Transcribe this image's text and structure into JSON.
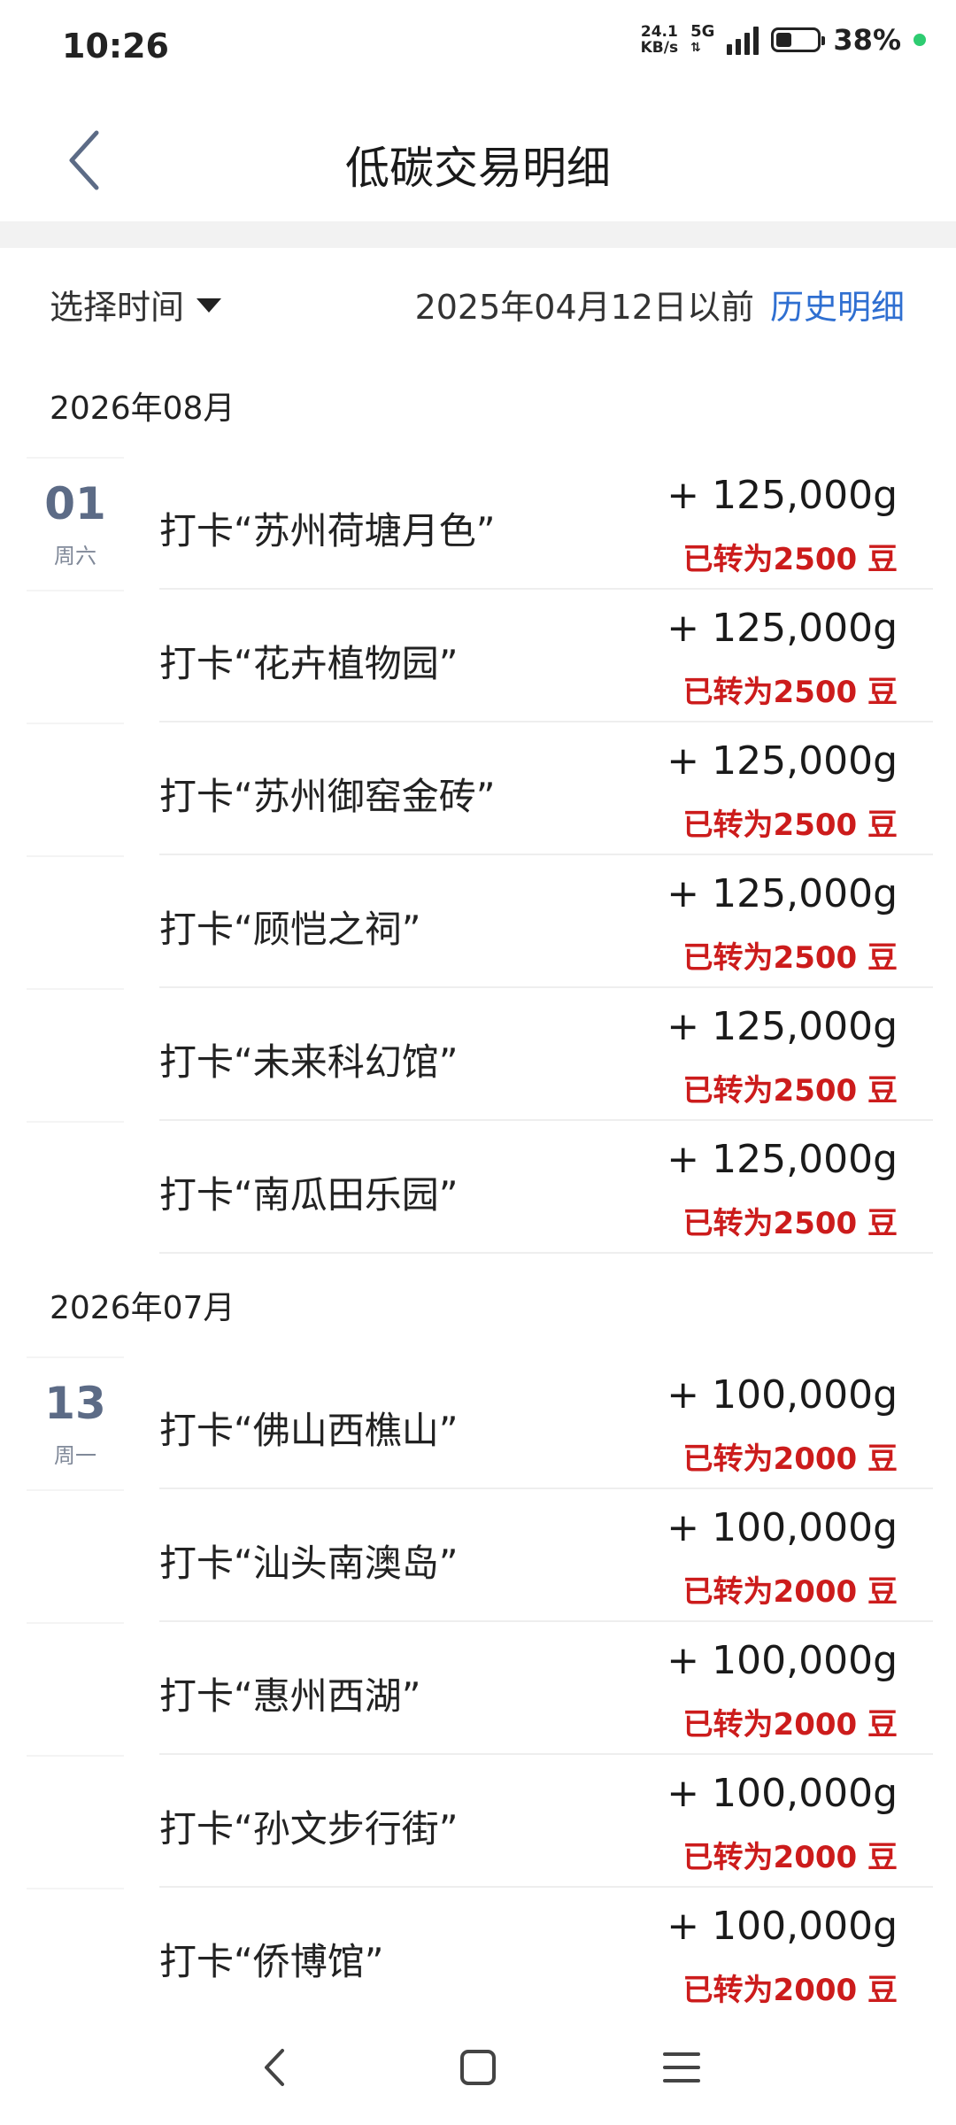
{
  "status_bar": {
    "time": "10:26",
    "speed_top": "24.1",
    "speed_bottom": "KB/s",
    "network": "5G",
    "battery_percent": "38%",
    "battery_level": 0.38
  },
  "header": {
    "title": "低碳交易明细"
  },
  "filter": {
    "select_label": "选择时间",
    "history_note": "2025年04月12日以前",
    "history_link": "历史明细"
  },
  "groups": [
    {
      "month": "2026年08月",
      "day": "01",
      "weekday": "周六",
      "items": [
        {
          "title": "打卡“苏州荷塘月色”",
          "amount": "+ 125,000g",
          "converted": "已转为2500 豆"
        },
        {
          "title": "打卡“花卉植物园”",
          "amount": "+ 125,000g",
          "converted": "已转为2500 豆"
        },
        {
          "title": "打卡“苏州御窑金砖”",
          "amount": "+ 125,000g",
          "converted": "已转为2500 豆"
        },
        {
          "title": "打卡“顾恺之祠”",
          "amount": "+ 125,000g",
          "converted": "已转为2500 豆"
        },
        {
          "title": "打卡“未来科幻馆”",
          "amount": "+ 125,000g",
          "converted": "已转为2500 豆"
        },
        {
          "title": "打卡“南瓜田乐园”",
          "amount": "+ 125,000g",
          "converted": "已转为2500 豆"
        }
      ]
    },
    {
      "month": "2026年07月",
      "day": "13",
      "weekday": "周一",
      "items": [
        {
          "title": "打卡“佛山西樵山”",
          "amount": "+ 100,000g",
          "converted": "已转为2000 豆"
        },
        {
          "title": "打卡“汕头南澳岛”",
          "amount": "+ 100,000g",
          "converted": "已转为2000 豆"
        },
        {
          "title": "打卡“惠州西湖”",
          "amount": "+ 100,000g",
          "converted": "已转为2000 豆"
        },
        {
          "title": "打卡“孙文步行街”",
          "amount": "+ 100,000g",
          "converted": "已转为2000 豆"
        },
        {
          "title": "打卡“侨博馆”",
          "amount": "+ 100,000g",
          "converted": "已转为2000 豆"
        }
      ]
    }
  ],
  "colors": {
    "accent_link": "#2f6fd1",
    "converted_red": "#cc1c1c",
    "date_blue_gray": "#5c6b86",
    "battery_dot": "#2ecc71"
  },
  "nav": {
    "back_icon": "back-triangle-icon",
    "home_icon": "home-square-icon",
    "menu_icon": "menu-lines-icon"
  }
}
